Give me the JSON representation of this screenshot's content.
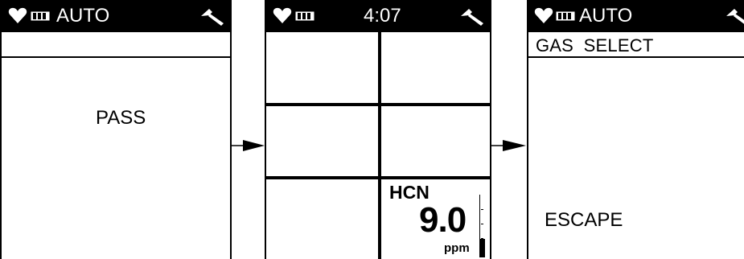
{
  "screen_1": {
    "status": {
      "mode": "AUTO"
    },
    "message": "PASS"
  },
  "screen_2": {
    "status": {
      "time": "4:07"
    },
    "sensor_tile": {
      "gas": "HCN",
      "value": "9.0",
      "unit": "ppm",
      "bar_level_fraction": 0.3
    }
  },
  "screen_3": {
    "status": {
      "mode": "AUTO"
    },
    "header": "GAS  SELECT",
    "option": "ESCAPE"
  },
  "icons": {
    "heart": "heart-icon",
    "battery": "battery-icon",
    "wrench": "wrench-icon",
    "arrow": "right-arrow-icon"
  },
  "colors": {
    "status_bar": "#000000",
    "display": "#ffffff",
    "ink": "#000000"
  }
}
